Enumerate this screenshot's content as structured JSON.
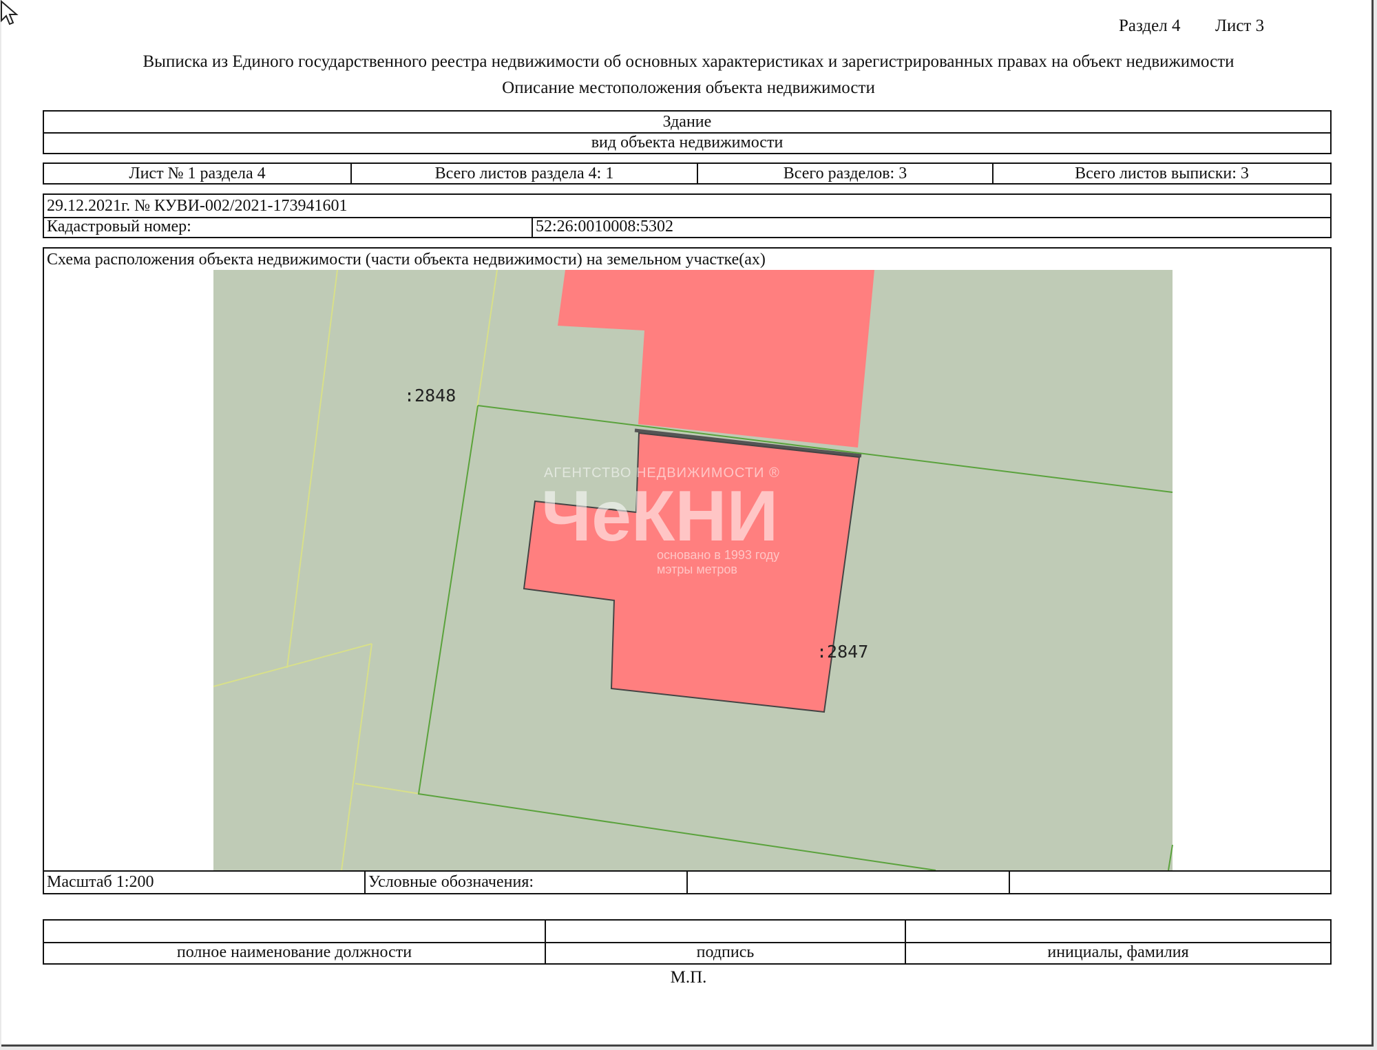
{
  "header": {
    "section": "Раздел 4",
    "sheet": "Лист 3",
    "title": "Выписка из Единого государственного реестра недвижимости об основных характеристиках и зарегистрированных правах на объект недвижимости",
    "subtitle": "Описание местоположения объекта недвижимости"
  },
  "object": {
    "type_value": "Здание",
    "type_caption": "вид объекта недвижимости"
  },
  "sheet_info": {
    "sheet_of_section": "Лист № 1 раздела 4",
    "total_sheets_section": "Всего листов раздела 4: 1",
    "total_sections": "Всего разделов: 3",
    "total_sheets_extract": "Всего листов выписки: 3"
  },
  "record": {
    "date_number": "29.12.2021г. № КУВИ-002/2021-173941601",
    "cadastral_label": "Кадастровый номер:",
    "cadastral_value": "52:26:0010008:5302"
  },
  "scheme": {
    "title": "Схема расположения объекта недвижимости (части объекта недвижимости) на земельном участке(ах)",
    "parcel_labels": [
      ":2848",
      ":2847"
    ],
    "colors": {
      "background": "#bfcbb6",
      "building": "#ff7f7f",
      "outer_boundary": "#d8e08a",
      "parcel_boundary": "#5aa23c"
    }
  },
  "watermark": {
    "agency": "АГЕНТСТВО   НЕДВИЖИМОСТИ ®",
    "brand": "ЧеКНИ",
    "tagline_1": "основано в 1993 году",
    "tagline_2": "мэтры метров"
  },
  "legend": {
    "scale": "Масштаб 1:200",
    "symbols": "Условные обозначения:"
  },
  "signature": {
    "position": "полное наименование должности",
    "sign": "подпись",
    "name": "инициалы, фамилия",
    "stamp": "М.П."
  }
}
